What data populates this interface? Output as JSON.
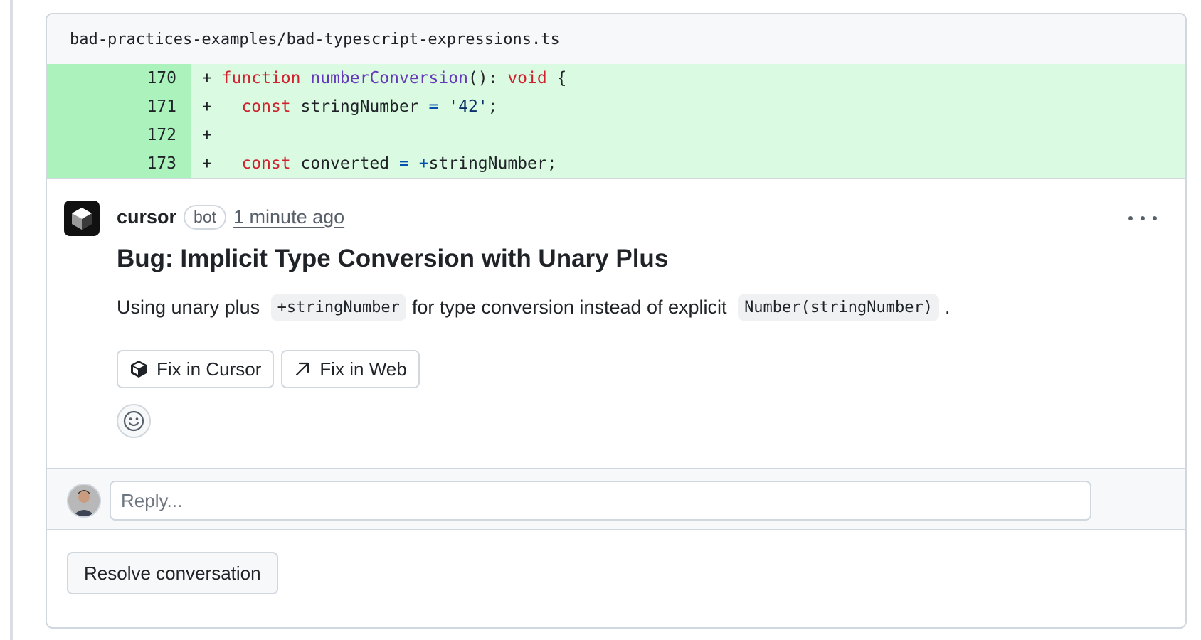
{
  "file": {
    "path": "bad-practices-examples/bad-typescript-expressions.ts"
  },
  "diff": {
    "lines": [
      {
        "number": "170",
        "marker": "+",
        "tokens": [
          {
            "t": " ",
            "c": ""
          },
          {
            "t": "function",
            "c": "kw"
          },
          {
            "t": " ",
            "c": ""
          },
          {
            "t": "numberConversion",
            "c": "fn"
          },
          {
            "t": "(): ",
            "c": ""
          },
          {
            "t": "void",
            "c": "kw"
          },
          {
            "t": " {",
            "c": ""
          }
        ]
      },
      {
        "number": "171",
        "marker": "+",
        "tokens": [
          {
            "t": "   ",
            "c": ""
          },
          {
            "t": "const",
            "c": "kw"
          },
          {
            "t": " stringNumber ",
            "c": ""
          },
          {
            "t": "=",
            "c": "op"
          },
          {
            "t": " ",
            "c": ""
          },
          {
            "t": "'42'",
            "c": "str"
          },
          {
            "t": ";",
            "c": ""
          }
        ]
      },
      {
        "number": "172",
        "marker": "+",
        "tokens": []
      },
      {
        "number": "173",
        "marker": "+",
        "tokens": [
          {
            "t": "   ",
            "c": ""
          },
          {
            "t": "const",
            "c": "kw"
          },
          {
            "t": " converted ",
            "c": ""
          },
          {
            "t": "=",
            "c": "op"
          },
          {
            "t": " ",
            "c": ""
          },
          {
            "t": "+",
            "c": "op"
          },
          {
            "t": "stringNumber;",
            "c": ""
          }
        ]
      }
    ]
  },
  "comment": {
    "author": "cursor",
    "badge": "bot",
    "timestamp": "1 minute ago",
    "title": "Bug: Implicit Type Conversion with Unary Plus",
    "body": {
      "text_1": "Using unary plus",
      "code_1": "+stringNumber",
      "text_2": "for type conversion instead of explicit",
      "code_2": "Number(stringNumber)",
      "text_3": "."
    },
    "actions": {
      "fix_cursor": "Fix in Cursor",
      "fix_web": "Fix in Web"
    }
  },
  "reply": {
    "placeholder": "Reply..."
  },
  "resolve": {
    "label": "Resolve conversation"
  },
  "colors": {
    "added_line_bg": "#dafbe1",
    "added_num_bg": "#abf2bc",
    "keyword": "#cf222e",
    "function": "#6639ba",
    "operator": "#0550ae",
    "string": "#0a3069"
  },
  "icons": {
    "bot_avatar": "cursor-cube-icon",
    "fix_cursor": "cube-icon",
    "fix_web": "arrow-up-right-icon",
    "emoji": "smiley-icon",
    "more": "kebab-horizontal-icon"
  }
}
